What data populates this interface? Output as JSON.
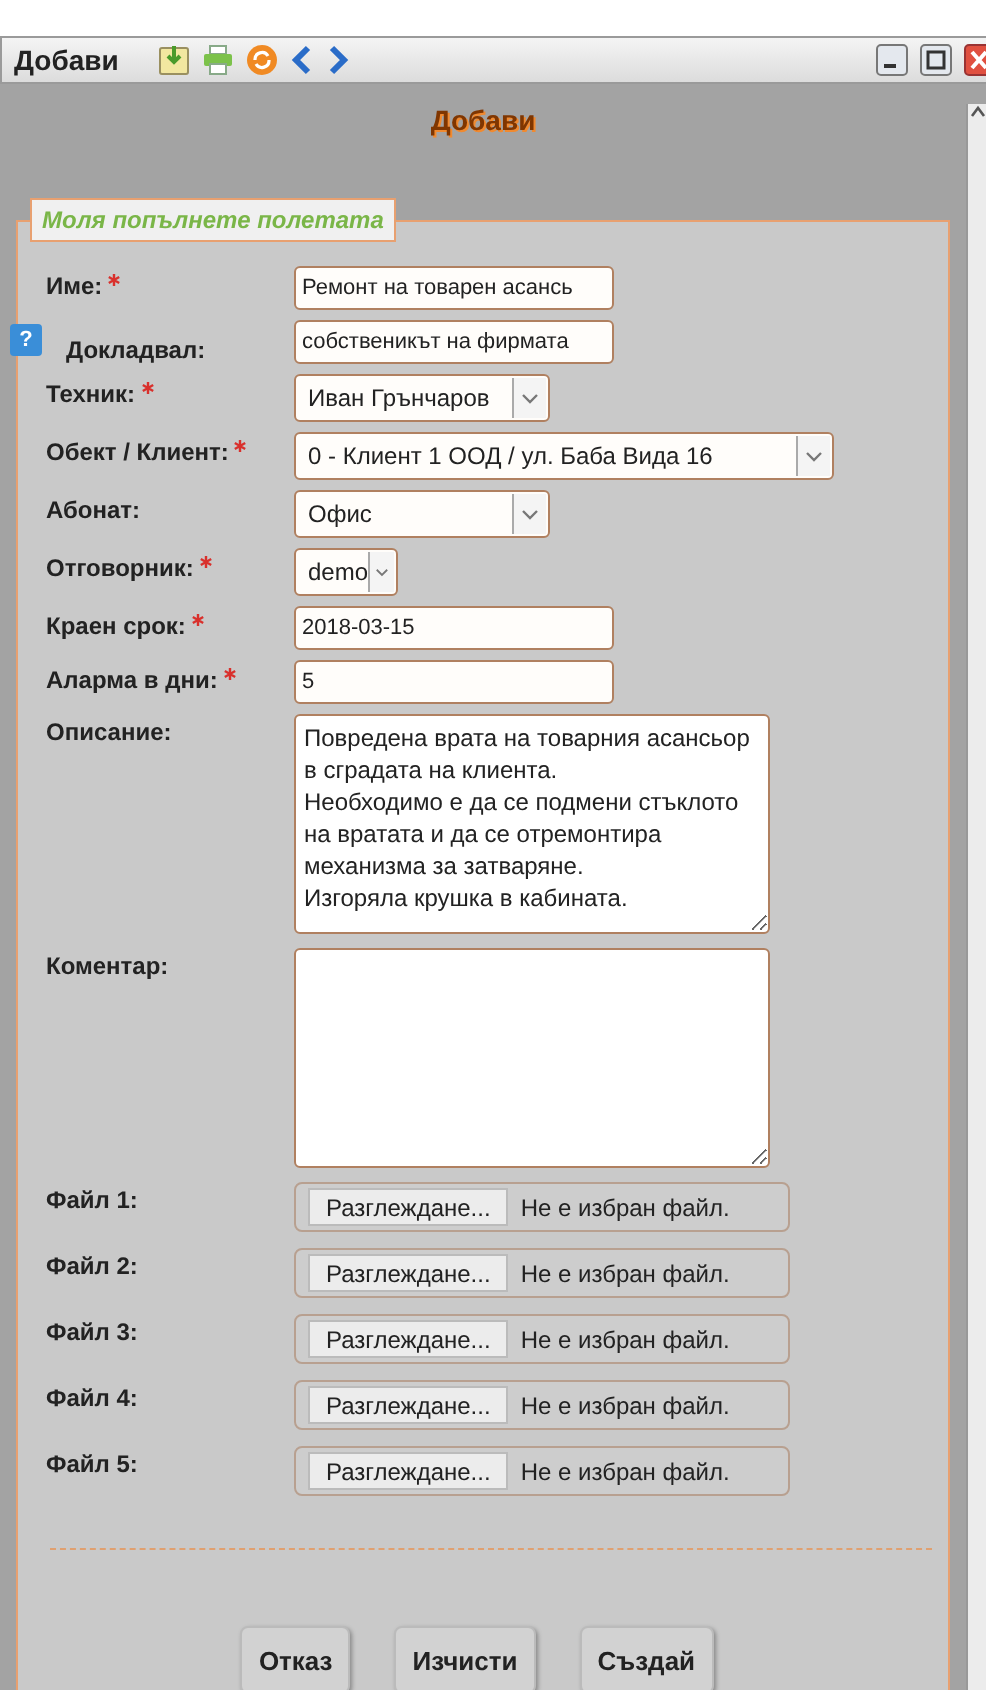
{
  "window": {
    "title": "Добави"
  },
  "page_title": "Добави",
  "legend": "Моля попълнете полетата",
  "fields": [
    {
      "kind": "text",
      "label": "Име:",
      "required": true,
      "value": "Ремонт на товарен асансь"
    },
    {
      "kind": "text",
      "label": "Докладвал:",
      "required": false,
      "help": "?",
      "value": "собственикът на фирмата"
    },
    {
      "kind": "select",
      "label": "Техник:",
      "required": true,
      "value": "Иван Грънчаров"
    },
    {
      "kind": "select",
      "label": "Обект / Клиент:",
      "required": true,
      "value": "0 - Клиент 1 ООД / ул. Баба Вида 16"
    },
    {
      "kind": "select",
      "label": "Абонат:",
      "required": false,
      "value": "Офис"
    },
    {
      "kind": "select",
      "label": "Отговорник:",
      "required": true,
      "value": "demo"
    },
    {
      "kind": "text",
      "label": "Краен срок:",
      "required": true,
      "value": "2018-03-15"
    },
    {
      "kind": "text",
      "label": "Аларма в дни:",
      "required": true,
      "value": "5"
    },
    {
      "kind": "textarea",
      "label": "Описание:",
      "required": false,
      "value": "Повредена врата на товарния асансьор\nв сградата на клиента.\nНеобходимо е да се подмени стъклото\nна вратата и да се отремонтира\nмеханизма за затваряне.\nИзгоряла крушка в кабината."
    },
    {
      "kind": "textarea",
      "label": "Коментар:",
      "required": false
    },
    {
      "kind": "file",
      "label": "Файл 1:",
      "required": false,
      "button": "Разглеждане...",
      "status": "Не е избран файл."
    },
    {
      "kind": "file",
      "label": "Файл 2:",
      "required": false,
      "button": "Разглеждане...",
      "status": "Не е избран файл."
    },
    {
      "kind": "file",
      "label": "Файл 3:",
      "required": false,
      "button": "Разглеждане...",
      "status": "Не е избран файл."
    },
    {
      "kind": "file",
      "label": "Файл 4:",
      "required": false,
      "button": "Разглеждане...",
      "status": "Не е избран файл."
    },
    {
      "kind": "file",
      "label": "Файл 5:",
      "required": false,
      "button": "Разглеждане...",
      "status": "Не е избран файл."
    }
  ],
  "buttons": [
    "Отказ",
    "Изчисти",
    "Създай"
  ]
}
